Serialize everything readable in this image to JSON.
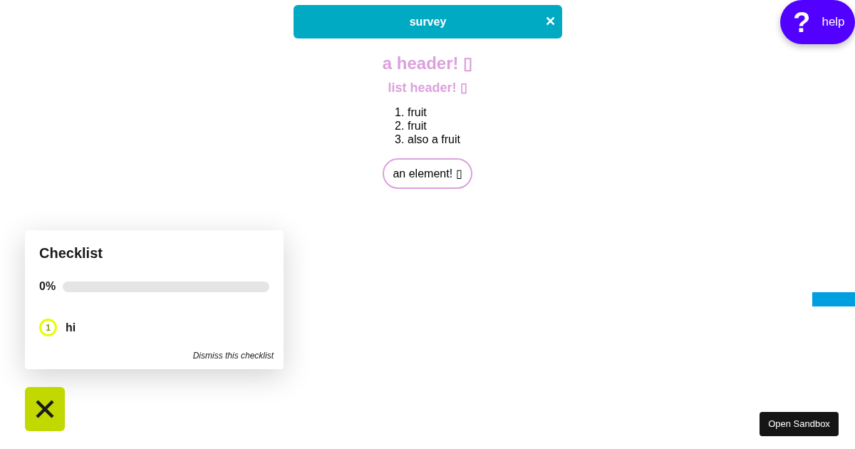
{
  "page": {
    "header": "a header! ▯",
    "list_header": "list header! ▯",
    "list": [
      {
        "number": "1.",
        "text": "fruit"
      },
      {
        "number": "2.",
        "text": "fruit"
      },
      {
        "number": "3.",
        "text": "also a fruit"
      }
    ],
    "element": "an element! ▯"
  },
  "survey_banner": {
    "title": "survey",
    "close": "✕"
  },
  "help_button": {
    "icon": "?",
    "label": "help"
  },
  "checklist": {
    "title": "Checklist",
    "percent": "0%",
    "items": [
      {
        "number": "1",
        "label": "hi",
        "color": "#e5ff00"
      }
    ],
    "dismiss": "Dismiss this checklist"
  },
  "sandbox_button": {
    "label": "Open Sandbox"
  }
}
